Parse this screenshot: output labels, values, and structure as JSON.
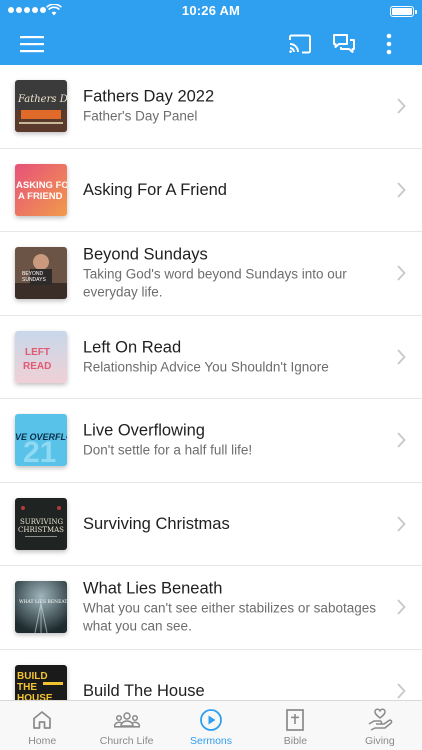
{
  "status_bar": {
    "time": "10:26 AM"
  },
  "colors": {
    "accent": "#2f9ff0",
    "tab_inactive": "#8a8a8a"
  },
  "nav": {
    "menu_icon": "hamburger-icon",
    "actions": [
      "cast-icon",
      "chat-icon",
      "more-vertical-icon"
    ]
  },
  "sermons": [
    {
      "title": "Fathers Day 2022",
      "subtitle": "Father's Day  Panel",
      "thumb_text": "Fathers Day"
    },
    {
      "title": "Asking For A Friend",
      "subtitle": "",
      "thumb_text": "ASKING FOR A FRIEND"
    },
    {
      "title": "Beyond Sundays",
      "subtitle": "Taking God's word beyond Sundays into our everyday life.",
      "thumb_text": "BEYOND SUNDAYS"
    },
    {
      "title": "Left On Read",
      "subtitle": "Relationship Advice You Shouldn't Ignore",
      "thumb_text": "LEFT ON READ"
    },
    {
      "title": "Live Overflowing",
      "subtitle": "Don't settle for a half full life!",
      "thumb_text": "LIVE OVERFLOWING"
    },
    {
      "title": "Surviving Christmas",
      "subtitle": "",
      "thumb_text": "SURVIVING CHRISTMAS"
    },
    {
      "title": "What Lies Beneath",
      "subtitle": "What you can't see either stabilizes or sabotages what you can see.",
      "thumb_text": "WHAT LIES BENEATH"
    },
    {
      "title": "Build The House",
      "subtitle": "",
      "thumb_text": "BUILD THE HOUSE"
    }
  ],
  "tabs": [
    {
      "label": "Home",
      "icon": "home-icon",
      "active": false
    },
    {
      "label": "Church Life",
      "icon": "people-icon",
      "active": false
    },
    {
      "label": "Sermons",
      "icon": "play-circle-icon",
      "active": true
    },
    {
      "label": "Bible",
      "icon": "bible-icon",
      "active": false
    },
    {
      "label": "Giving",
      "icon": "giving-hand-icon",
      "active": false
    }
  ]
}
